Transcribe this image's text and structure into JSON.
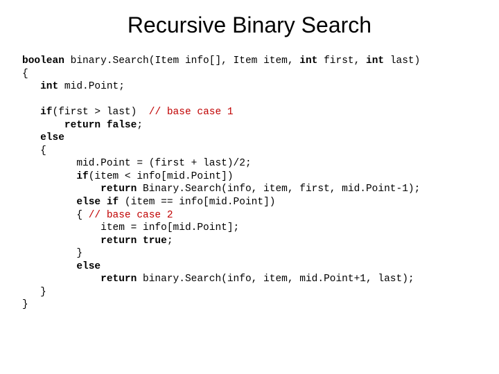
{
  "title": "Recursive Binary Search",
  "code": {
    "l1a": "boolean",
    "l1b": " binary.Search(Item info[], Item item, ",
    "l1c": "int",
    "l1d": " first, ",
    "l1e": "int",
    "l1f": " last)",
    "l2": "{",
    "l3a": "   int",
    "l3b": " mid.Point;",
    "l4": "",
    "l5a": "   if",
    "l5b": "(first > last)  ",
    "l5c": "// base case 1",
    "l6a": "       return false",
    "l6b": ";",
    "l7a": "   else",
    "l8": "   {",
    "l9": "         mid.Point = (first + last)/2;",
    "l10a": "         if",
    "l10b": "(item < info[mid.Point])",
    "l11a": "             return",
    "l11b": " Binary.Search(info, item, first, mid.Point-1);",
    "l12a": "         else if",
    "l12b": " (item == info[mid.Point])",
    "l13a": "         { ",
    "l13b": "// base case 2",
    "l14": "             item = info[mid.Point];",
    "l15a": "             return true",
    "l15b": ";",
    "l16": "         }",
    "l17a": "         else",
    "l18a": "             return",
    "l18b": " binary.Search(info, item, mid.Point+1, last);",
    "l19": "   }",
    "l20": "}"
  }
}
